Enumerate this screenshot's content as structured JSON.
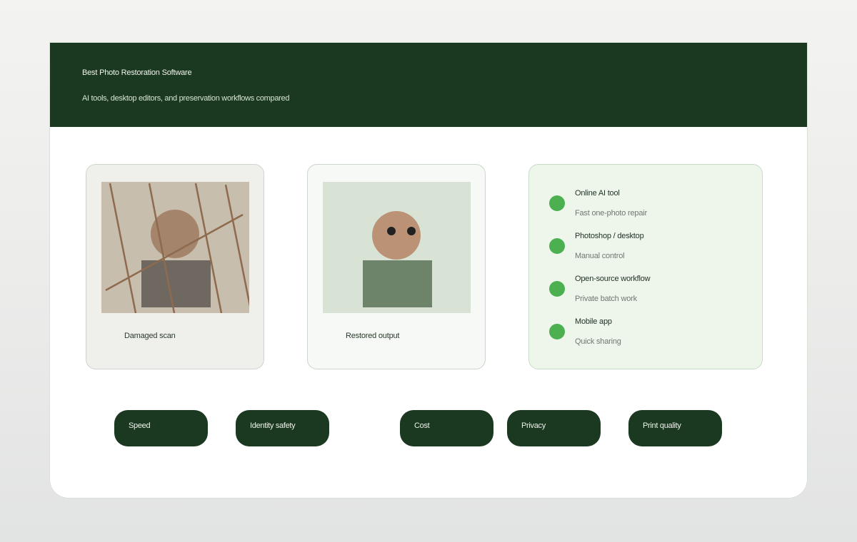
{
  "header": {
    "title": "Best Photo Restoration Software",
    "subtitle": "AI tools, desktop editors, and preservation workflows compared"
  },
  "comparison": {
    "damaged_caption": "Damaged scan",
    "restored_caption": "Restored output"
  },
  "options": [
    {
      "name": "Online AI tool",
      "desc": "Fast one-photo repair"
    },
    {
      "name": "Photoshop / desktop",
      "desc": "Manual control"
    },
    {
      "name": "Open-source workflow",
      "desc": "Private batch work"
    },
    {
      "name": "Mobile app",
      "desc": "Quick sharing"
    }
  ],
  "criteria": [
    "Speed",
    "Identity safety",
    "Cost",
    "Privacy",
    "Print quality"
  ],
  "colors": {
    "header_bg": "#1b3820",
    "accent_dot": "#4caf50",
    "chip_bg": "#1b3820",
    "damaged_photo_bg": "#c8beae",
    "restored_photo_bg": "#d8e3d5"
  }
}
